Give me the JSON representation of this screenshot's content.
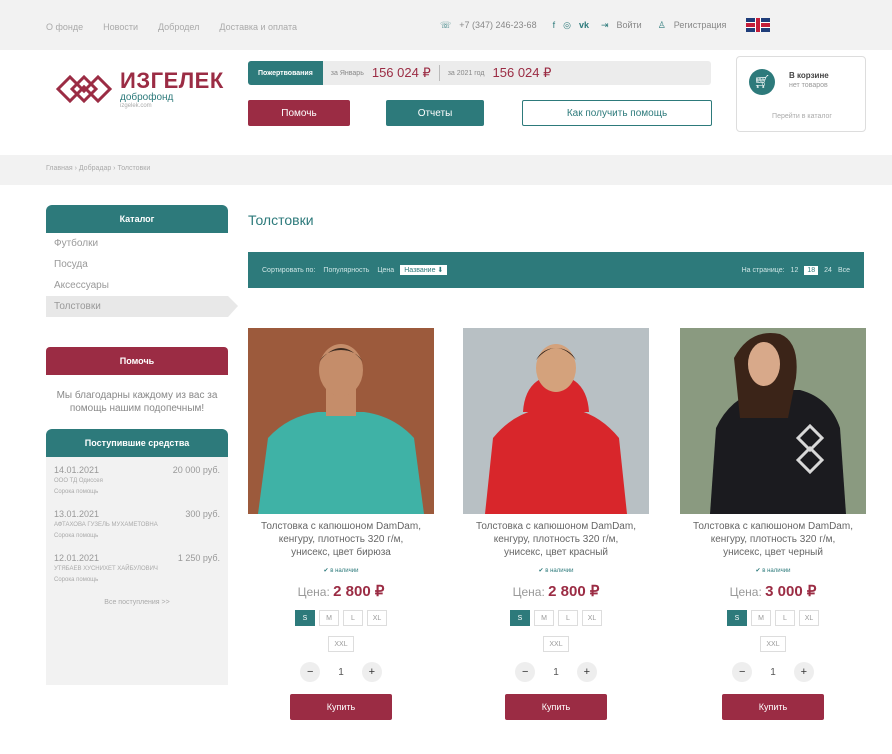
{
  "top_nav": {
    "items": [
      "О фонде",
      "Новости",
      "Добродел",
      "Доставка и оплата"
    ],
    "phone": "+7 (347) 246-23-68",
    "login": "Войти",
    "register": "Регистрация"
  },
  "logo": {
    "title": "ИЗГЕЛЕК",
    "subtitle": "доброфонд",
    "url": "izgelek.com"
  },
  "donations": {
    "label": "Пожертвования",
    "month_label": "за Январь",
    "month_amount": "156 024 ₽",
    "year_label": "за 2021 год",
    "year_amount": "156 024 ₽"
  },
  "buttons": {
    "help": "Помочь",
    "reports": "Отчеты",
    "how_to": "Как получить помощь"
  },
  "cart": {
    "title": "В корзине",
    "status": "нет товаров",
    "link": "Перейти в каталог"
  },
  "breadcrumb": "Главная › Добрадар › Толстовки",
  "sidebar": {
    "catalog_title": "Каталог",
    "categories": [
      "Футболки",
      "Посуда",
      "Аксессуары",
      "Толстовки"
    ],
    "help_title": "Помочь",
    "help_text": "Мы благодарны каждому из вас за помощь нашим подопечным!",
    "funds_title": "Поступившие средства",
    "funds": [
      {
        "date": "14.01.2021",
        "amount": "20 000 руб.",
        "name": "ООО ТД Одиссея",
        "note": "Сорока помощь"
      },
      {
        "date": "13.01.2021",
        "amount": "300 руб.",
        "name": "АФТАХОВА ГУЗЕЛЬ МУХАМЕТОВНА",
        "note": "Сорока помощь"
      },
      {
        "date": "12.01.2021",
        "amount": "1 250 руб.",
        "name": "УТЯБАЕВ ХУСНИХЕТ ХАЙБУЛОВИЧ",
        "note": "Сорока помощь"
      }
    ],
    "all_funds": "Все поступления >>"
  },
  "main": {
    "title": "Толстовки",
    "sort": {
      "label": "Сортировать по:",
      "popularity": "Популярность",
      "price": "Цена",
      "name": "Название ⬇"
    },
    "perpage": {
      "label": "На странице:",
      "options": [
        "12",
        "18",
        "24",
        "Все"
      ]
    }
  },
  "products": [
    {
      "name": "Толстовка с капюшоном DamDam, кенгуру, плотность 320 г/м, унисекс, цвет бирюза",
      "stock": "✔ в наличии",
      "price_label": "Цена:",
      "price": "2 800 ₽",
      "sizes": [
        "S",
        "M",
        "L",
        "XL",
        "XXL"
      ],
      "qty": "1",
      "buy": "Купить",
      "shirt": "#3fb2a6",
      "hair": "#3a2a20",
      "skin": "#c58d6a",
      "bg": "#9c5a3c"
    },
    {
      "name": "Толстовка с капюшоном DamDam, кенгуру, плотность 320 г/м, унисекс, цвет красный",
      "stock": "✔ в наличии",
      "price_label": "Цена:",
      "price": "2 800 ₽",
      "sizes": [
        "S",
        "M",
        "L",
        "XL",
        "XXL"
      ],
      "qty": "1",
      "buy": "Купить",
      "shirt": "#d8262b",
      "hair": "#2a1e18",
      "skin": "#d4a27c",
      "bg": "#b8c0c4"
    },
    {
      "name": "Толстовка с капюшоном DamDam, кенгуру, плотность 320 г/м, унисекс, цвет черный",
      "stock": "✔ в наличии",
      "price_label": "Цена:",
      "price": "3 000 ₽",
      "sizes": [
        "S",
        "M",
        "L",
        "XL",
        "XXL"
      ],
      "qty": "1",
      "buy": "Купить",
      "shirt": "#1b1b1f",
      "hair": "#3b2418",
      "skin": "#d8a98a",
      "bg": "#8a9a80"
    }
  ],
  "colors": {
    "teal": "#2d7a7b",
    "wine": "#9b2c44"
  }
}
